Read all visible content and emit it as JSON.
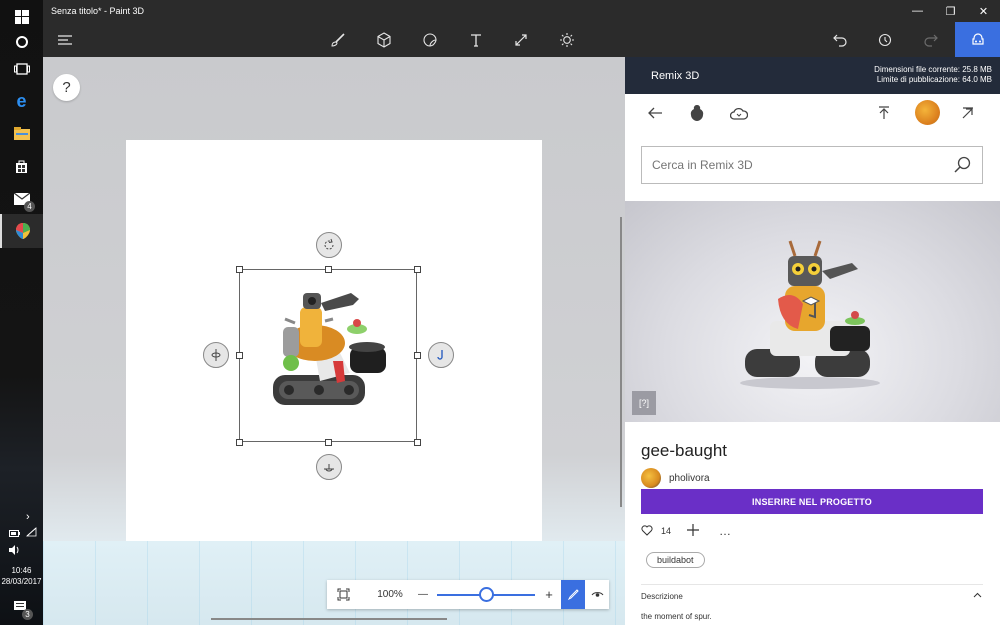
{
  "window": {
    "title": "Senza titolo* - Paint 3D",
    "controls": {
      "minimize": "—",
      "maximize": "❐",
      "close": "✕"
    }
  },
  "toolbar": {
    "menu_icon": "hamburger-menu-icon",
    "tools": [
      "brush-icon",
      "3d-cube-icon",
      "sticker-icon",
      "text-icon",
      "canvas-icon",
      "effects-icon"
    ],
    "right": [
      "undo-icon",
      "history-icon",
      "redo-icon",
      "remix3d-icon"
    ],
    "active_tool": "remix3d-icon",
    "accent": "#3a6fe0"
  },
  "taskbar": {
    "mail_badge": "4",
    "notification_badge": "3",
    "chevron": "›",
    "time": "10:46",
    "date": "28/03/2017"
  },
  "canvas": {
    "help": "?",
    "zoom": {
      "value": "100%",
      "minus": "—",
      "plus": "+",
      "level": 0.5
    }
  },
  "panel": {
    "title": "Remix 3D",
    "file_size": "Dimensioni file corrente: 25.8 MB",
    "publish_limit": "Limite di pubblicazione: 64.0 MB",
    "search_placeholder": "Cerca in Remix 3D",
    "ar_label": "[?]",
    "model_name": "gee-baught",
    "author": "pholivora",
    "insert_button": "INSERIRE NEL PROGETTO",
    "likes": "14",
    "more": "…",
    "tag": "buildabot",
    "description_label": "Descrizione",
    "description_text": "the moment of spur.",
    "insert_color": "#6a2fc7",
    "header_color": "#232b3a"
  }
}
